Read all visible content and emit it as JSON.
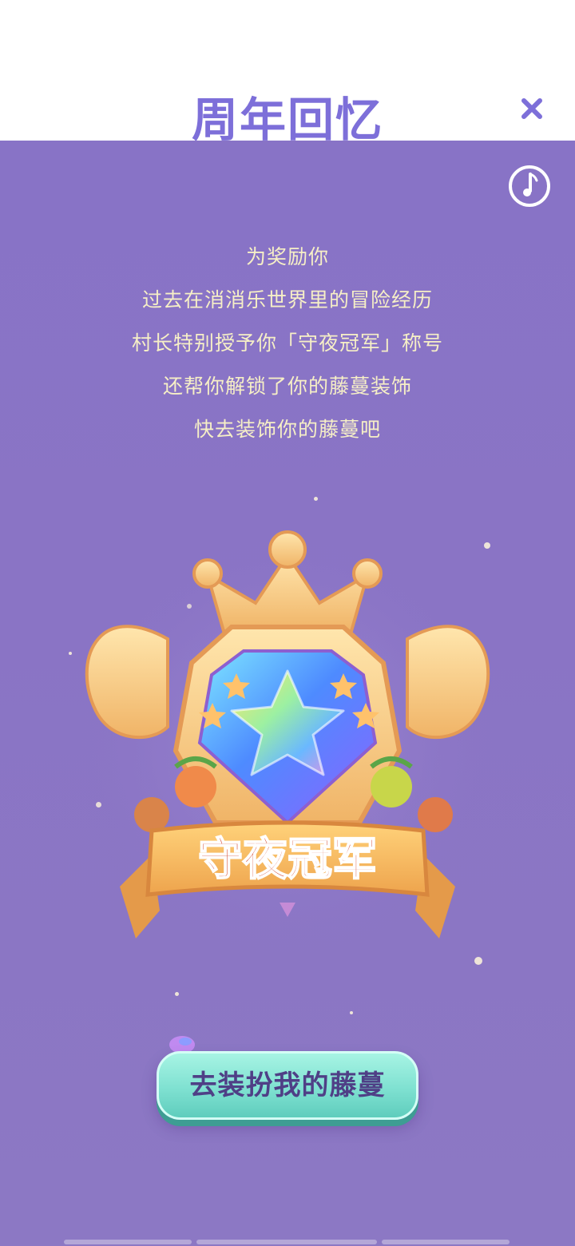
{
  "header": {
    "title": "周年回忆"
  },
  "story": {
    "lines": [
      "为奖励你",
      "过去在消消乐世界里的冒险经历",
      "村长特别授予你「守夜冠军」称号",
      "还帮你解锁了你的藤蔓装饰",
      "快去装饰你的藤蔓吧"
    ]
  },
  "badge": {
    "banner_text": "守夜冠军"
  },
  "cta": {
    "label": "去装扮我的藤蔓"
  },
  "colors": {
    "title": "#7d6fd9",
    "background": "#8873c6",
    "story_text": "#f6efc6",
    "cta_fill": "#7fe1d1",
    "cta_text": "#4f3f86"
  },
  "icons": {
    "close": "close-icon",
    "music": "music-note-icon"
  }
}
